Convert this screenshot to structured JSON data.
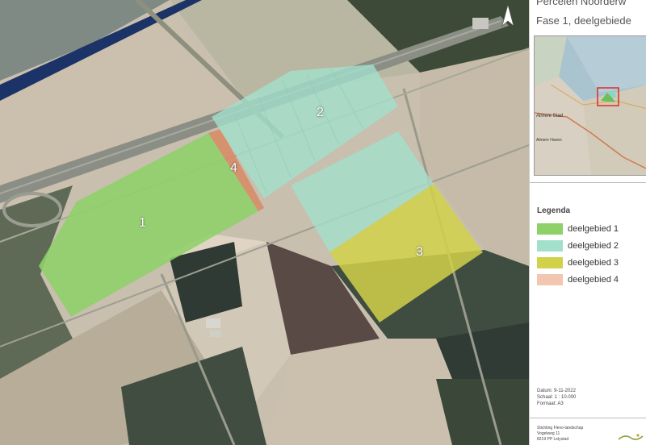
{
  "header": {
    "title_line1": "Percelen Noorderw",
    "title_line2": "Fase 1, deelgebiede"
  },
  "map": {
    "plot_labels": [
      "1",
      "2",
      "3",
      "4"
    ],
    "compass_label": "N"
  },
  "legend": {
    "title": "Legenda",
    "items": [
      {
        "label": "deelgebied 1",
        "color": "#8ed169"
      },
      {
        "label": "deelgebied 2",
        "color": "#a3e0cc"
      },
      {
        "label": "deelgebied 3",
        "color": "#d1d14a"
      },
      {
        "label": "deelgebied 4",
        "color": "#f2c6b0"
      }
    ]
  },
  "inset": {
    "labels": [
      "Almere Stad",
      "Almere Haven"
    ]
  },
  "meta": {
    "date": "Datum: 9-11-2022",
    "scale": "Schaal: 1 : 10.000",
    "format": "Formaat: A3"
  },
  "org": {
    "name": "Stichting Flevo-landschap",
    "street": "Vogelweg 11",
    "city": "8219 PP Lelystad"
  }
}
